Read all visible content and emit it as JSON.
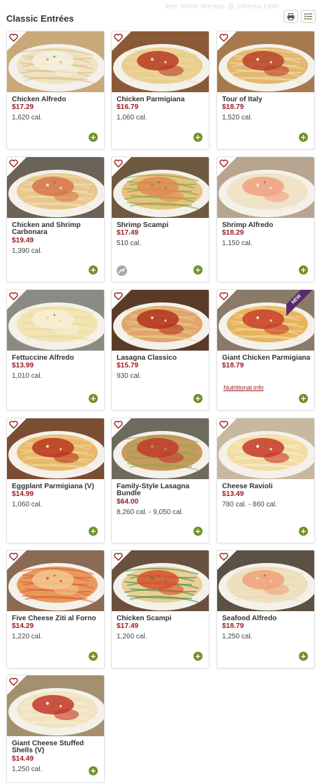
{
  "watermark": "see more menus @ zmenu.com",
  "page_title": "Classic Entrées",
  "tools": {
    "print": "print-icon",
    "list": "list-icon"
  },
  "accent_colors": {
    "price": "#9a1c1f",
    "add": "#6e9128",
    "new_badge": "#5a2a6e"
  },
  "items": [
    {
      "name": "Chicken Alfredo",
      "price": "$17.29",
      "cal": "1,620 cal."
    },
    {
      "name": "Chicken Parmigiana",
      "price": "$16.79",
      "cal": "1,060 cal."
    },
    {
      "name": "Tour of Italy",
      "price": "$18.79",
      "cal": "1,520 cal."
    },
    {
      "name": "Chicken and Shrimp Carbonara",
      "price": "$19.49",
      "cal": "1,390 cal."
    },
    {
      "name": "Shrimp Scampi",
      "price": "$17.49",
      "cal": "510 cal."
    },
    {
      "name": "Shrimp Alfredo",
      "price": "$18.29",
      "cal": "1,150 cal."
    },
    {
      "name": "Fettuccine Alfredo",
      "price": "$13.99",
      "cal": "1,010 cal."
    },
    {
      "name": "Lasagna Classico",
      "price": "$15.79",
      "cal": "930 cal."
    },
    {
      "name": "Giant Chicken Parmigiana",
      "price": "$18.79",
      "cal": "",
      "badge": "NEW",
      "link": "Nutritional info"
    },
    {
      "name": "Eggplant Parmigiana (V)",
      "price": "$14.99",
      "cal": "1,060 cal."
    },
    {
      "name": "Family-Style Lasagna Bundle",
      "price": "$64.00",
      "cal": "8,260 cal. - 9,050 cal."
    },
    {
      "name": "Cheese Ravioli",
      "price": "$13.49",
      "cal": "780 cal. - 860 cal."
    },
    {
      "name": "Five Cheese Ziti al Forno",
      "price": "$14.29",
      "cal": "1,220 cal."
    },
    {
      "name": "Chicken Scampi",
      "price": "$17.49",
      "cal": "1,260 cal."
    },
    {
      "name": "Seafood Alfredo",
      "price": "$18.79",
      "cal": "1,250 cal."
    },
    {
      "name": "Giant Cheese Stuffed Shells (V)",
      "price": "$14.49",
      "cal": "1,250 cal."
    }
  ]
}
